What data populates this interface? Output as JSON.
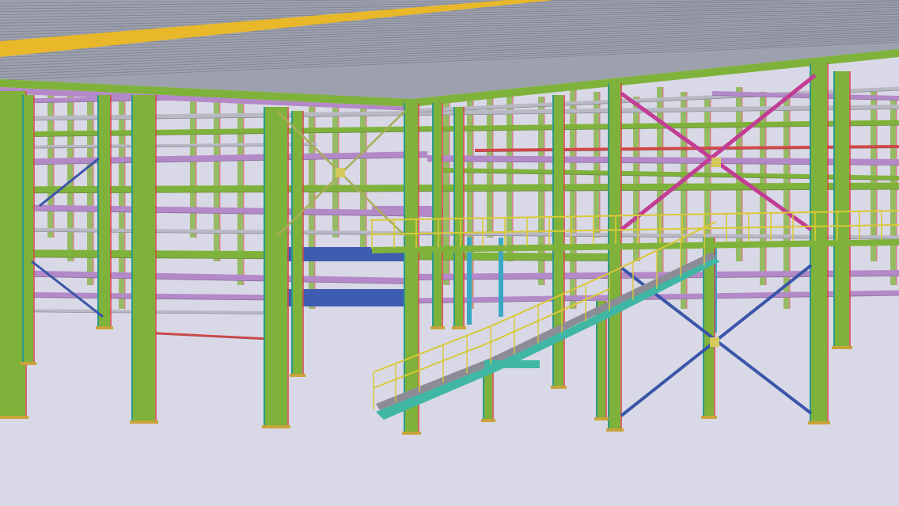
{
  "scene": {
    "label": "",
    "colors": {
      "background": "#d9d8e6",
      "column": "#7fb23a",
      "column_edge": "#2c9a8a",
      "beam_purple": "#b489c8",
      "beam_grey": "#b9b9c4",
      "brace_magenta": "#c23d94",
      "brace_blue": "#3a55a8",
      "brace_olive": "#a7ad5a",
      "handrail": "#d9c938",
      "stair": "#3fb7a4",
      "deck": "#9da1ad",
      "deck_yellow": "#e8b82a",
      "deck_dark": "#6d707a",
      "red_line": "#d44848",
      "blue_plate": "#3f5db0",
      "cyan_post": "#3aa8c4"
    }
  }
}
